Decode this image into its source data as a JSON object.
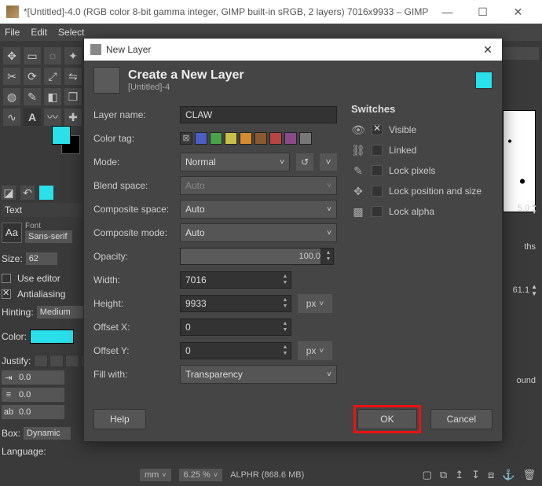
{
  "window": {
    "title": "*[Untitled]-4.0 (RGB color 8-bit gamma integer, GIMP built-in sRGB, 2 layers) 7016x9933 – GIMP"
  },
  "menu": {
    "file": "File",
    "edit": "Edit",
    "select": "Select"
  },
  "text_panel": {
    "header": "Text",
    "font_label": "Font",
    "font_value": "Sans-serif",
    "size_label": "Size:",
    "size_value": "62",
    "use_editor": "Use editor",
    "antialiasing": "Antialiasing",
    "hinting_label": "Hinting:",
    "hinting_value": "Medium",
    "color_label": "Color:",
    "justify_label": "Justify:",
    "indent1": "0.0",
    "indent2": "0.0",
    "indent3": "0.0",
    "box_label": "Box:",
    "box_value": "Dynamic",
    "language_label": "Language:"
  },
  "dialog": {
    "title": "New Layer",
    "header_title": "Create a New Layer",
    "header_sub": "[Untitled]-4",
    "labels": {
      "layer_name": "Layer name:",
      "color_tag": "Color tag:",
      "mode": "Mode:",
      "blend_space": "Blend space:",
      "composite_space": "Composite space:",
      "composite_mode": "Composite mode:",
      "opacity": "Opacity:",
      "width": "Width:",
      "height": "Height:",
      "offset_x": "Offset X:",
      "offset_y": "Offset Y:",
      "fill_with": "Fill with:"
    },
    "values": {
      "layer_name": "CLAW",
      "mode": "Normal",
      "blend_space": "Auto",
      "composite_space": "Auto",
      "composite_mode": "Auto",
      "opacity": "100.0",
      "width": "7016",
      "height": "9933",
      "offset_x": "0",
      "offset_y": "0",
      "fill_with": "Transparency",
      "unit": "px"
    },
    "color_tags": [
      "#3a3a3a",
      "#4a5fc1",
      "#4aa14a",
      "#c9c04a",
      "#d68a2e",
      "#8a5a2e",
      "#b74545",
      "#8a4a8a",
      "#777777"
    ],
    "switches": {
      "title": "Switches",
      "visible": "Visible",
      "linked": "Linked",
      "lock_pixels": "Lock pixels",
      "lock_position": "Lock position and size",
      "lock_alpha": "Lock alpha"
    },
    "buttons": {
      "help": "Help",
      "ok": "OK",
      "cancel": "Cancel"
    }
  },
  "status": {
    "unit": "mm",
    "zoom": "6.25 %",
    "info": "ALPHR (868.6 MB)"
  },
  "right": {
    "spin1": "5.0",
    "spin2": "61.1",
    "paths": "ths",
    "ound": "ound"
  }
}
